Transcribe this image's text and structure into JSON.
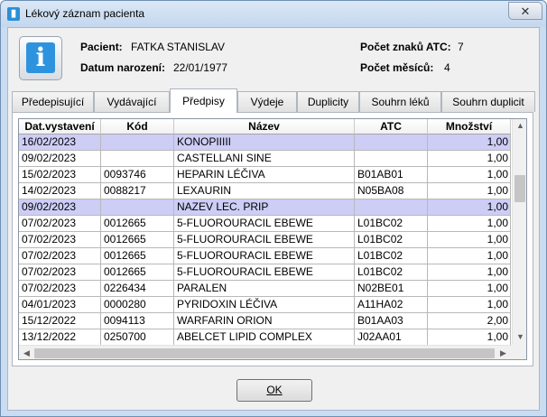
{
  "window": {
    "title": "Lékový záznam pacienta",
    "close_glyph": "✕"
  },
  "patient": {
    "name_label": "Pacient:",
    "name": "FATKA STANISLAV",
    "dob_label": "Datum narození:",
    "dob": "22/01/1977",
    "atc_count_label": "Počet znaků ATC:",
    "atc_count": "7",
    "months_label": "Počet měsíců:",
    "months": "4"
  },
  "tabs": [
    "Předepisující",
    "Vydávající",
    "Předpisy",
    "Výdeje",
    "Duplicity",
    "Souhrn léků",
    "Souhrn duplicit"
  ],
  "active_tab": "Předpisy",
  "table": {
    "columns": [
      "Dat.vystavení",
      "Kód",
      "Název",
      "ATC",
      "Množství"
    ],
    "rows": [
      {
        "date": "16/02/2023",
        "code": "",
        "name": "KONOPIIIII",
        "atc": "",
        "qty": "1,00",
        "highlighted": true
      },
      {
        "date": "09/02/2023",
        "code": "",
        "name": "CASTELLANI SINE",
        "atc": "",
        "qty": "1,00",
        "highlighted": false
      },
      {
        "date": "15/02/2023",
        "code": "0093746",
        "name": "HEPARIN LÉČIVA",
        "atc": "B01AB01",
        "qty": "1,00",
        "highlighted": false
      },
      {
        "date": "14/02/2023",
        "code": "0088217",
        "name": "LEXAURIN",
        "atc": "N05BA08",
        "qty": "1,00",
        "highlighted": false
      },
      {
        "date": "09/02/2023",
        "code": "",
        "name": "NAZEV LEC. PRIP",
        "atc": "",
        "qty": "1,00",
        "highlighted": true
      },
      {
        "date": "07/02/2023",
        "code": "0012665",
        "name": "5-FLUOROURACIL EBEWE",
        "atc": "L01BC02",
        "qty": "1,00",
        "highlighted": false
      },
      {
        "date": "07/02/2023",
        "code": "0012665",
        "name": "5-FLUOROURACIL EBEWE",
        "atc": "L01BC02",
        "qty": "1,00",
        "highlighted": false
      },
      {
        "date": "07/02/2023",
        "code": "0012665",
        "name": "5-FLUOROURACIL EBEWE",
        "atc": "L01BC02",
        "qty": "1,00",
        "highlighted": false
      },
      {
        "date": "07/02/2023",
        "code": "0012665",
        "name": "5-FLUOROURACIL EBEWE",
        "atc": "L01BC02",
        "qty": "1,00",
        "highlighted": false
      },
      {
        "date": "07/02/2023",
        "code": "0226434",
        "name": "PARALEN",
        "atc": "N02BE01",
        "qty": "1,00",
        "highlighted": false
      },
      {
        "date": "04/01/2023",
        "code": "0000280",
        "name": "PYRIDOXIN LÉČIVA",
        "atc": "A11HA02",
        "qty": "1,00",
        "highlighted": false
      },
      {
        "date": "15/12/2022",
        "code": "0094113",
        "name": "WARFARIN ORION",
        "atc": "B01AA03",
        "qty": "2,00",
        "highlighted": false
      },
      {
        "date": "13/12/2022",
        "code": "0250700",
        "name": "ABELCET LIPID COMPLEX",
        "atc": "J02AA01",
        "qty": "1,00",
        "highlighted": false
      }
    ]
  },
  "ok_button": {
    "label": "OK"
  },
  "colors": {
    "selected_row": "#cdcdf6",
    "window_frame": "#c9dcf0",
    "info_icon": "#2e93de"
  }
}
